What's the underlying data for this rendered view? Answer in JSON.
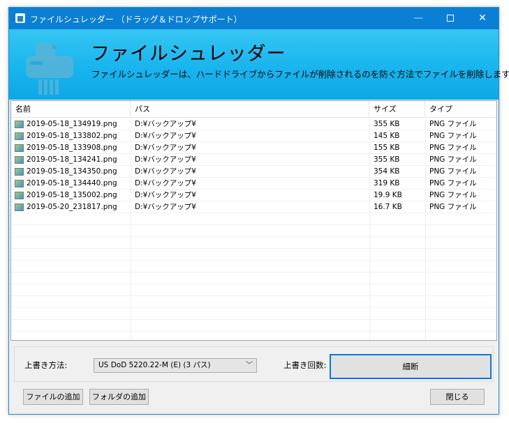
{
  "window": {
    "title": "ファイルシュレッダー （ドラッグ＆ドロップサポート）",
    "controls": {
      "minimize": "—",
      "close": "✕"
    }
  },
  "banner": {
    "title": "ファイルシュレッダー",
    "subtitle": "ファイルシュレッダーは、ハードドライブからファイルが削除されるのを防ぐ方法でファイルを削除します。"
  },
  "list": {
    "columns": {
      "name": "名前",
      "path": "パス",
      "size": "サイズ",
      "type": "タイプ"
    },
    "rows": [
      {
        "name": "2019-05-18_134919.png",
        "path": "D:¥バックアップ¥",
        "size": "355 KB",
        "type": "PNG ファイル"
      },
      {
        "name": "2019-05-18_133802.png",
        "path": "D:¥バックアップ¥",
        "size": "145 KB",
        "type": "PNG ファイル"
      },
      {
        "name": "2019-05-18_133908.png",
        "path": "D:¥バックアップ¥",
        "size": "155 KB",
        "type": "PNG ファイル"
      },
      {
        "name": "2019-05-18_134241.png",
        "path": "D:¥バックアップ¥",
        "size": "355 KB",
        "type": "PNG ファイル"
      },
      {
        "name": "2019-05-18_134350.png",
        "path": "D:¥バックアップ¥",
        "size": "354 KB",
        "type": "PNG ファイル"
      },
      {
        "name": "2019-05-18_134440.png",
        "path": "D:¥バックアップ¥",
        "size": "319 KB",
        "type": "PNG ファイル"
      },
      {
        "name": "2019-05-18_135002.png",
        "path": "D:¥バックアップ¥",
        "size": "19.9 KB",
        "type": "PNG ファイル"
      },
      {
        "name": "2019-05-20_231817.png",
        "path": "D:¥バックアップ¥",
        "size": "16.7 KB",
        "type": "PNG ファイル"
      }
    ]
  },
  "options": {
    "method_label": "上書き方法:",
    "method_value": "US DoD 5220.22-M (E) (3 パス)",
    "passes_label": "上書き回数:",
    "shred_button": "細断"
  },
  "buttons": {
    "add_file": "ファイルの追加",
    "add_folder": "フォルダの追加",
    "close": "閉じる"
  },
  "colors": {
    "titlebar": "#0a7fd4",
    "banner": "#16b3ee",
    "accent_border": "#0a78d7"
  }
}
